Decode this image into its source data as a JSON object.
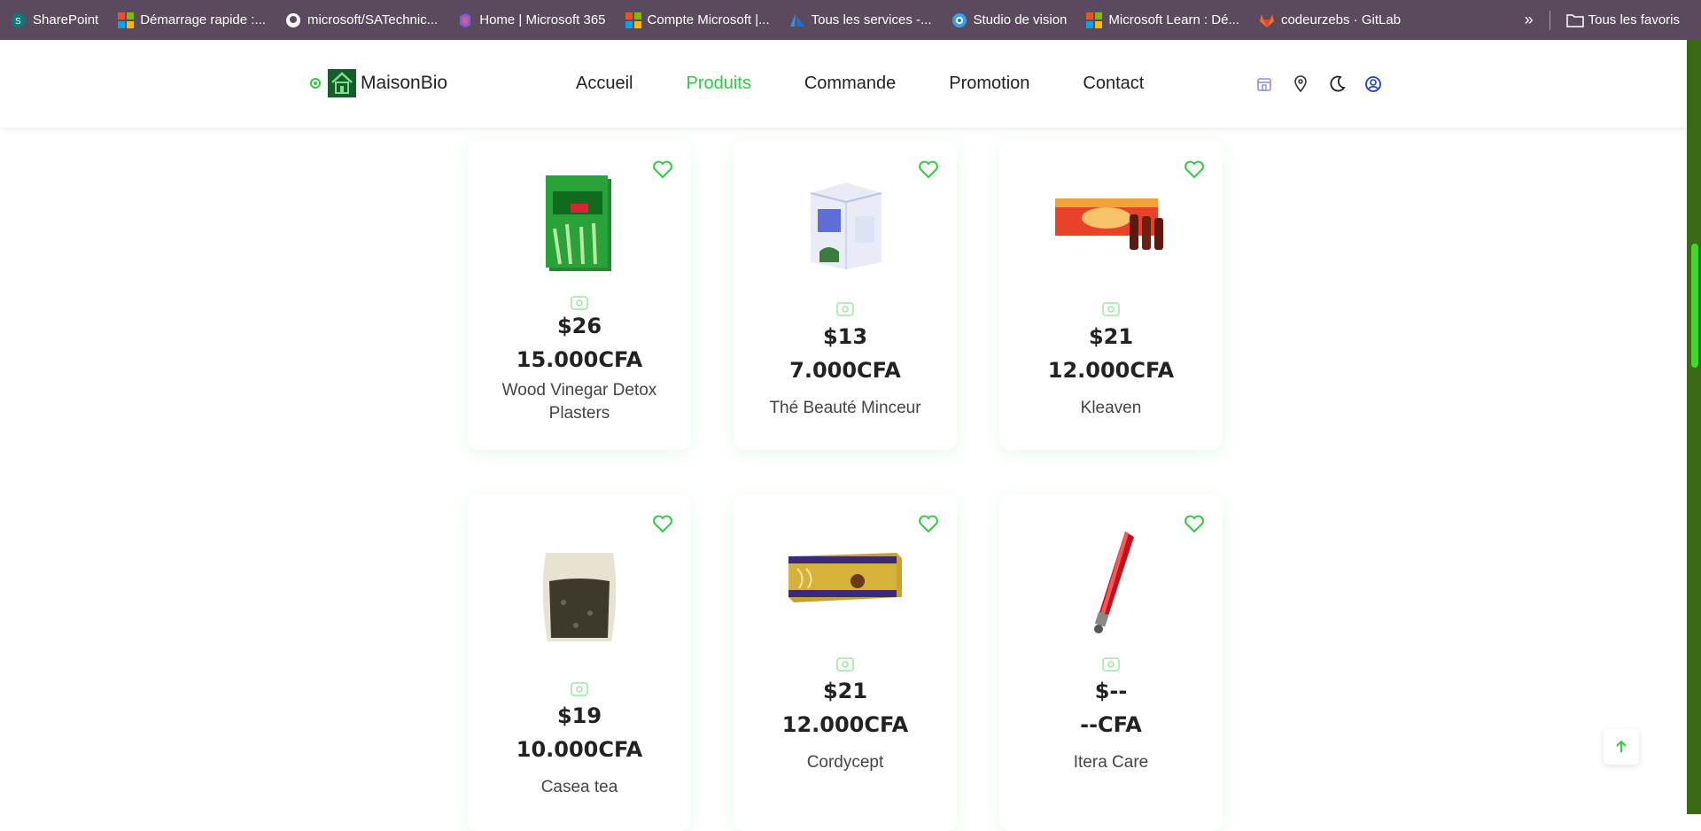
{
  "bookmarks": {
    "items": [
      {
        "label": "SharePoint",
        "icon": "sharepoint-icon"
      },
      {
        "label": "Démarrage rapide :...",
        "icon": "microsoft-icon"
      },
      {
        "label": "microsoft/SATechnic...",
        "icon": "github-icon"
      },
      {
        "label": "Home | Microsoft 365",
        "icon": "m365-icon"
      },
      {
        "label": "Compte Microsoft |...",
        "icon": "microsoft-icon"
      },
      {
        "label": "Tous les services -...",
        "icon": "azure-icon"
      },
      {
        "label": "Studio de vision",
        "icon": "vision-icon"
      },
      {
        "label": "Microsoft Learn : Dé...",
        "icon": "microsoft-icon"
      },
      {
        "label": "codeurzebs · GitLab",
        "icon": "gitlab-icon"
      }
    ],
    "more": "»",
    "favorites_label": "Tous les favoris"
  },
  "header": {
    "brand": "MaisonBio",
    "nav": [
      {
        "label": "Accueil",
        "active": false
      },
      {
        "label": "Produits",
        "active": true
      },
      {
        "label": "Commande",
        "active": false
      },
      {
        "label": "Promotion",
        "active": false
      },
      {
        "label": "Contact",
        "active": false
      }
    ],
    "icons": [
      "store-icon",
      "location-icon",
      "moon-icon",
      "user-icon"
    ]
  },
  "products": [
    {
      "name": "Wood Vinegar Detox Plasters",
      "price_usd": "$26",
      "price_cfa": "15.000CFA"
    },
    {
      "name": "Thé Beauté Minceur",
      "price_usd": "$13",
      "price_cfa": "7.000CFA"
    },
    {
      "name": "Kleaven",
      "price_usd": "$21",
      "price_cfa": "12.000CFA"
    },
    {
      "name": "Casea tea",
      "price_usd": "$19",
      "price_cfa": "10.000CFA"
    },
    {
      "name": "Cordycept",
      "price_usd": "$21",
      "price_cfa": "12.000CFA"
    },
    {
      "name": "Itera Care",
      "price_usd": "$--",
      "price_cfa": "--CFA"
    }
  ],
  "colors": {
    "accent": "#2ecc40",
    "bookmarks_bg": "#5b4a5e",
    "text": "#222222"
  }
}
